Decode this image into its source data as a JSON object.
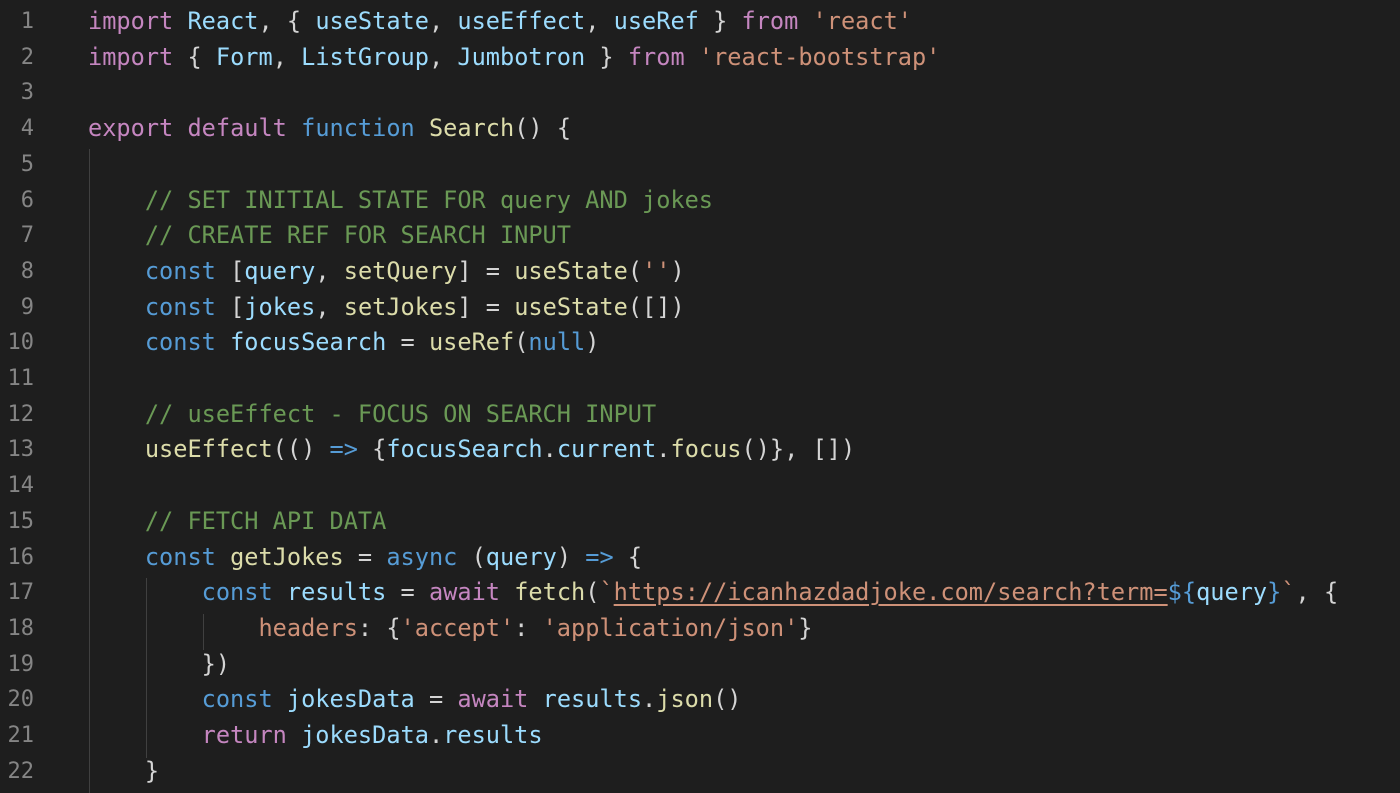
{
  "editor": {
    "theme": {
      "background": "#1e1e1e",
      "line_number": "#858585",
      "keyword": "#c586c0",
      "storage": "#569cd6",
      "function": "#dcdcaa",
      "variable": "#9cdcfe",
      "string": "#ce9178",
      "comment": "#6a9955"
    },
    "lines": [
      {
        "number": "1",
        "tokens": [
          {
            "t": "import",
            "c": "kw"
          },
          {
            "t": " "
          },
          {
            "t": "React",
            "c": "vr"
          },
          {
            "t": ", { "
          },
          {
            "t": "useState",
            "c": "vr"
          },
          {
            "t": ", "
          },
          {
            "t": "useEffect",
            "c": "vr"
          },
          {
            "t": ", "
          },
          {
            "t": "useRef",
            "c": "vr"
          },
          {
            "t": " } "
          },
          {
            "t": "from",
            "c": "kw"
          },
          {
            "t": " "
          },
          {
            "t": "'react'",
            "c": "str"
          }
        ]
      },
      {
        "number": "2",
        "tokens": [
          {
            "t": "import",
            "c": "kw"
          },
          {
            "t": " { "
          },
          {
            "t": "Form",
            "c": "vr"
          },
          {
            "t": ", "
          },
          {
            "t": "ListGroup",
            "c": "vr"
          },
          {
            "t": ", "
          },
          {
            "t": "Jumbotron",
            "c": "vr"
          },
          {
            "t": " } "
          },
          {
            "t": "from",
            "c": "kw"
          },
          {
            "t": " "
          },
          {
            "t": "'react-bootstrap'",
            "c": "str"
          }
        ]
      },
      {
        "number": "3",
        "tokens": []
      },
      {
        "number": "4",
        "tokens": [
          {
            "t": "export",
            "c": "kw"
          },
          {
            "t": " "
          },
          {
            "t": "default",
            "c": "kw"
          },
          {
            "t": " "
          },
          {
            "t": "function",
            "c": "st"
          },
          {
            "t": " "
          },
          {
            "t": "Search",
            "c": "fn"
          },
          {
            "t": "() {"
          }
        ]
      },
      {
        "number": "5",
        "tokens": []
      },
      {
        "number": "6",
        "tokens": [
          {
            "t": "    "
          },
          {
            "t": "// SET INITIAL STATE FOR query AND jokes",
            "c": "cm"
          }
        ]
      },
      {
        "number": "7",
        "tokens": [
          {
            "t": "    "
          },
          {
            "t": "// CREATE REF FOR SEARCH INPUT",
            "c": "cm"
          }
        ]
      },
      {
        "number": "8",
        "tokens": [
          {
            "t": "    "
          },
          {
            "t": "const",
            "c": "st"
          },
          {
            "t": " ["
          },
          {
            "t": "query",
            "c": "vr"
          },
          {
            "t": ", "
          },
          {
            "t": "setQuery",
            "c": "fn"
          },
          {
            "t": "] = "
          },
          {
            "t": "useState",
            "c": "fn"
          },
          {
            "t": "("
          },
          {
            "t": "''",
            "c": "str"
          },
          {
            "t": ")"
          }
        ]
      },
      {
        "number": "9",
        "tokens": [
          {
            "t": "    "
          },
          {
            "t": "const",
            "c": "st"
          },
          {
            "t": " ["
          },
          {
            "t": "jokes",
            "c": "vr"
          },
          {
            "t": ", "
          },
          {
            "t": "setJokes",
            "c": "fn"
          },
          {
            "t": "] = "
          },
          {
            "t": "useState",
            "c": "fn"
          },
          {
            "t": "([])"
          }
        ]
      },
      {
        "number": "10",
        "tokens": [
          {
            "t": "    "
          },
          {
            "t": "const",
            "c": "st"
          },
          {
            "t": " "
          },
          {
            "t": "focusSearch",
            "c": "vr"
          },
          {
            "t": " = "
          },
          {
            "t": "useRef",
            "c": "fn"
          },
          {
            "t": "("
          },
          {
            "t": "null",
            "c": "st"
          },
          {
            "t": ")"
          }
        ]
      },
      {
        "number": "11",
        "tokens": []
      },
      {
        "number": "12",
        "tokens": [
          {
            "t": "    "
          },
          {
            "t": "// useEffect - FOCUS ON SEARCH INPUT",
            "c": "cm"
          }
        ]
      },
      {
        "number": "13",
        "tokens": [
          {
            "t": "    "
          },
          {
            "t": "useEffect",
            "c": "fn"
          },
          {
            "t": "(() "
          },
          {
            "t": "=>",
            "c": "st"
          },
          {
            "t": " {"
          },
          {
            "t": "focusSearch",
            "c": "vr"
          },
          {
            "t": "."
          },
          {
            "t": "current",
            "c": "vr"
          },
          {
            "t": "."
          },
          {
            "t": "focus",
            "c": "fn"
          },
          {
            "t": "()}, [])"
          }
        ]
      },
      {
        "number": "14",
        "tokens": []
      },
      {
        "number": "15",
        "tokens": [
          {
            "t": "    "
          },
          {
            "t": "// FETCH API DATA",
            "c": "cm"
          }
        ]
      },
      {
        "number": "16",
        "tokens": [
          {
            "t": "    "
          },
          {
            "t": "const",
            "c": "st"
          },
          {
            "t": " "
          },
          {
            "t": "getJokes",
            "c": "fn"
          },
          {
            "t": " = "
          },
          {
            "t": "async",
            "c": "st"
          },
          {
            "t": " ("
          },
          {
            "t": "query",
            "c": "vr"
          },
          {
            "t": ") "
          },
          {
            "t": "=>",
            "c": "st"
          },
          {
            "t": " {"
          }
        ]
      },
      {
        "number": "17",
        "tokens": [
          {
            "t": "        "
          },
          {
            "t": "const",
            "c": "st"
          },
          {
            "t": " "
          },
          {
            "t": "results",
            "c": "vr"
          },
          {
            "t": " = "
          },
          {
            "t": "await",
            "c": "kw"
          },
          {
            "t": " "
          },
          {
            "t": "fetch",
            "c": "fn"
          },
          {
            "t": "("
          },
          {
            "t": "`",
            "c": "str"
          },
          {
            "t": "https://icanhazdadjoke.com/search?term=",
            "c": "url"
          },
          {
            "t": "${",
            "c": "tpl"
          },
          {
            "t": "query",
            "c": "vr"
          },
          {
            "t": "}",
            "c": "tpl"
          },
          {
            "t": "`",
            "c": "str"
          },
          {
            "t": ", {"
          }
        ]
      },
      {
        "number": "18",
        "tokens": [
          {
            "t": "            "
          },
          {
            "t": "headers",
            "c": "str"
          },
          {
            "t": ": {"
          },
          {
            "t": "'accept'",
            "c": "str"
          },
          {
            "t": ": "
          },
          {
            "t": "'application/json'",
            "c": "str"
          },
          {
            "t": "}"
          }
        ]
      },
      {
        "number": "19",
        "tokens": [
          {
            "t": "        })"
          }
        ]
      },
      {
        "number": "20",
        "tokens": [
          {
            "t": "        "
          },
          {
            "t": "const",
            "c": "st"
          },
          {
            "t": " "
          },
          {
            "t": "jokesData",
            "c": "vr"
          },
          {
            "t": " = "
          },
          {
            "t": "await",
            "c": "kw"
          },
          {
            "t": " "
          },
          {
            "t": "results",
            "c": "vr"
          },
          {
            "t": "."
          },
          {
            "t": "json",
            "c": "fn"
          },
          {
            "t": "()"
          }
        ]
      },
      {
        "number": "21",
        "tokens": [
          {
            "t": "        "
          },
          {
            "t": "return",
            "c": "kw"
          },
          {
            "t": " "
          },
          {
            "t": "jokesData",
            "c": "vr"
          },
          {
            "t": "."
          },
          {
            "t": "results",
            "c": "vr"
          }
        ]
      },
      {
        "number": "22",
        "tokens": [
          {
            "t": "    }"
          }
        ]
      }
    ]
  }
}
